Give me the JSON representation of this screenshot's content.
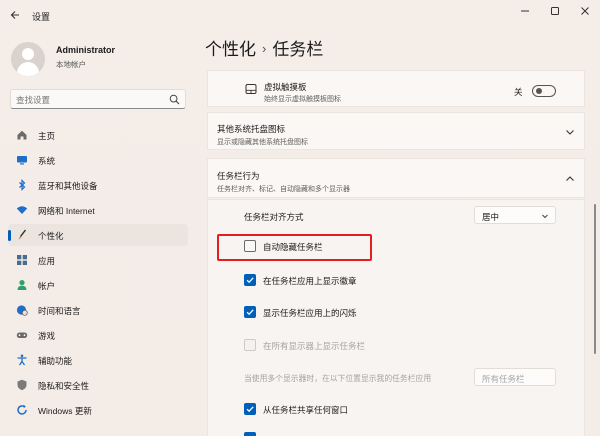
{
  "window": {
    "title": "设置",
    "controls": {
      "minimize": "—",
      "maximize": "☐",
      "close": "✕"
    }
  },
  "user": {
    "name": "Administrator",
    "account_type": "本地帐户"
  },
  "search": {
    "placeholder": "查找设置"
  },
  "nav": {
    "items": [
      {
        "label": "主页",
        "icon": "home-icon"
      },
      {
        "label": "系统",
        "icon": "system-icon"
      },
      {
        "label": "蓝牙和其他设备",
        "icon": "bluetooth-icon"
      },
      {
        "label": "网络和 Internet",
        "icon": "wifi-icon"
      },
      {
        "label": "个性化",
        "icon": "brush-icon",
        "active": true
      },
      {
        "label": "应用",
        "icon": "apps-icon"
      },
      {
        "label": "帐户",
        "icon": "account-icon"
      },
      {
        "label": "时间和语言",
        "icon": "globe-clock-icon"
      },
      {
        "label": "游戏",
        "icon": "gamepad-icon"
      },
      {
        "label": "辅助功能",
        "icon": "accessibility-icon"
      },
      {
        "label": "隐私和安全性",
        "icon": "shield-icon"
      },
      {
        "label": "Windows 更新",
        "icon": "update-icon"
      }
    ]
  },
  "header": {
    "parent": "个性化",
    "separator": "›",
    "current": "任务栏"
  },
  "touchpad": {
    "title": "虚拟触摸板",
    "subtitle": "始终显示虚拟触摸板图标",
    "toggle_label": "关",
    "toggle_on": false
  },
  "tray": {
    "title": "其他系统托盘图标",
    "subtitle": "显示或隐藏其他系统托盘图标"
  },
  "behaviors": {
    "title": "任务栏行为",
    "subtitle": "任务栏对齐、标记、自动隐藏和多个显示器",
    "alignment_label": "任务栏对齐方式",
    "alignment_value": "居中",
    "options": [
      {
        "label": "自动隐藏任务栏",
        "state": "unchecked"
      },
      {
        "label": "在任务栏应用上显示徽章",
        "state": "checked"
      },
      {
        "label": "显示任务栏应用上的闪烁",
        "state": "checked"
      },
      {
        "label": "在所有显示器上显示任务栏",
        "state": "disabled"
      }
    ],
    "multi_display_label": "当使用多个显示器时，在以下位置显示我的任务栏应用",
    "multi_display_value": "所有任务栏",
    "share_window_label": "从任务栏共享任何窗口",
    "share_window_state": "checked"
  },
  "colors": {
    "accent": "#005fb8",
    "highlight": "#e02020"
  }
}
